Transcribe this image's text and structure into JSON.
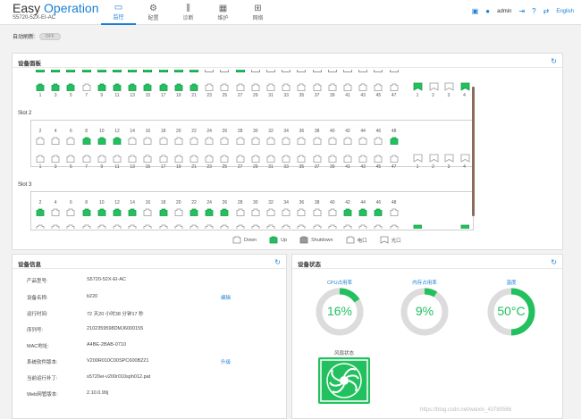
{
  "header": {
    "logo_easy": "Easy",
    "logo_op": " Operation",
    "model": "S5720-52X-EI-AC",
    "nav": [
      {
        "label": "监控",
        "icon": "monitor-icon",
        "active": true
      },
      {
        "label": "配置",
        "icon": "gear-icon",
        "active": false
      },
      {
        "label": "诊断",
        "icon": "diagnose-icon",
        "active": false
      },
      {
        "label": "维护",
        "icon": "maintain-icon",
        "active": false
      },
      {
        "label": "网络",
        "icon": "network-icon",
        "active": false
      }
    ],
    "user": "admin",
    "lang": "English"
  },
  "autorefresh": {
    "label": "自动刷新:",
    "state": "OFF"
  },
  "device_panel": {
    "title": "设备面板",
    "slots": [
      "Slot 2",
      "Slot 3"
    ],
    "legend": {
      "down": "Down",
      "up": "Up",
      "shutdown": "Shutdown",
      "elec": "电口",
      "optical": "光口"
    }
  },
  "info_panel": {
    "title": "设备信息",
    "rows": [
      {
        "label": "产品型号:",
        "value": "S5720-52X-EI-AC"
      },
      {
        "label": "设备名称:",
        "value": "b220"
      },
      {
        "label": "运行时间:",
        "value": "72 天20 小时38 分钟17 秒"
      },
      {
        "label": "序列号:",
        "value": "2102359598DMJ6000155"
      },
      {
        "label": "MAC地址:",
        "value": "A4BE-2BAB-0710"
      },
      {
        "label": "系统软件版本:",
        "value": "V200R010C00SPC600B221"
      },
      {
        "label": "当前运行补丁:",
        "value": "s5720ei-v200r010sph012.pat"
      },
      {
        "label": "Web网管版本:",
        "value": "2.10.0.99j"
      }
    ],
    "edit": "编辑",
    "upgrade": "升级"
  },
  "status_panel": {
    "title": "设备状态",
    "gauges": [
      {
        "label": "CPU占用率",
        "value": "16%",
        "fraction": 0.16
      },
      {
        "label": "内存占用率",
        "value": "9%",
        "fraction": 0.09
      },
      {
        "label": "温度",
        "value": "50°C",
        "fraction": 0.5
      }
    ],
    "fan_label": "风扇状态"
  },
  "watermark": "https://blog.csdn.net/weixin_43780566",
  "port_numbers_top": [
    "2",
    "4",
    "6",
    "8",
    "10",
    "12",
    "14",
    "16",
    "18",
    "20",
    "22",
    "24",
    "26",
    "28",
    "30",
    "32",
    "34",
    "36",
    "38",
    "40",
    "42",
    "44",
    "46",
    "48"
  ],
  "port_numbers_bottom": [
    "1",
    "3",
    "5",
    "7",
    "9",
    "11",
    "13",
    "15",
    "17",
    "19",
    "21",
    "23",
    "25",
    "27",
    "29",
    "31",
    "33",
    "35",
    "37",
    "39",
    "41",
    "43",
    "45",
    "47"
  ],
  "sfp_numbers": [
    "1",
    "2",
    "3",
    "4"
  ]
}
